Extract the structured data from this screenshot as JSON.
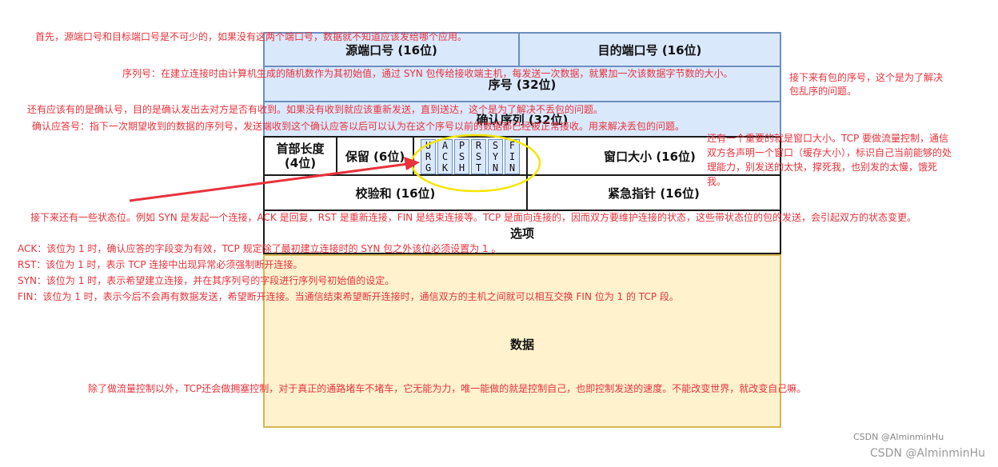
{
  "header": {
    "src_port": "源端口号 (16位)",
    "dst_port": "目的端口号 (16位)",
    "seq": "序号 (32位)",
    "ack": "确认序列 (32位)",
    "hdr_len_1": "首部长度",
    "hdr_len_2": "(4位)",
    "reserved": "保留 (6位)",
    "flags": [
      {
        "chars": [
          "U",
          "R",
          "G"
        ]
      },
      {
        "chars": [
          "A",
          "C",
          "K"
        ]
      },
      {
        "chars": [
          "P",
          "S",
          "H"
        ]
      },
      {
        "chars": [
          "R",
          "S",
          "T"
        ]
      },
      {
        "chars": [
          "S",
          "Y",
          "N"
        ]
      },
      {
        "chars": [
          "F",
          "I",
          "N"
        ]
      }
    ],
    "window": "窗口大小 (16位)",
    "checksum": "校验和 (16位)",
    "urgent": "紧急指针 (16位)",
    "options": "选项",
    "data": "数据"
  },
  "notes": {
    "ports": "首先，源端口号和目标端口号是不可少的，如果没有这两个端口号，数据就不知道应该发给哪个应用。",
    "seq": "序列号：在建立连接时由计算机生成的随机数作为其初始值，通过 SYN 包传给接收端主机，每发送一次数据，就累加一次该数据字节数的大小。",
    "seq_right": "接下来有包的序号，这个是为了解决包乱序的问题。",
    "ack_intro": "还有应该有的是确认号，目的是确认发出去对方是否有收到。如果没有收到就应该重新发送，直到送达，这个是为了解决不丢包的问题。",
    "ack_def": "确认应答号：指下一次期望收到的数据的序列号，发送端收到这个确认应答以后可以认为在这个序号以前的数据都已经被正常接收。用来解决丢包的问题。",
    "window": "还有一个重要的就是窗口大小。TCP 要做流量控制，通信双方各声明一个窗口（缓存大小），标识自己当前能够的处理能力，别发送的太快，撑死我，也别发的太慢，饿死我。",
    "flags_intro": "接下来还有一些状态位。例如 SYN 是发起一个连接，ACK 是回复，RST 是重新连接，FIN 是结束连接等。TCP 是面向连接的，因而双方要维护连接的状态，这些带状态位的包的发送，会引起双方的状态变更。",
    "ack_flag": "ACK：该位为 1 时，确认应答的字段变为有效，TCP 规定除了最初建立连接时的 SYN 包之外该位必须设置为 1 。",
    "rst_flag": "RST：该位为 1 时，表示 TCP 连接中出现异常必须强制断开连接。",
    "syn_flag": "SYN：该位为 1 时，表示希望建立连接，并在其序列号的字段进行序列号初始值的设定。",
    "fin_flag": "FIN：该位为 1 时，表示今后不会再有数据发送，希望断开连接。当通信结束希望断开连接时，通信双方的主机之间就可以相互交换 FIN 位为 1 的 TCP 段。",
    "congestion": "除了做流量控制以外，TCP还会做拥塞控制，对于真正的通路堵车不堵车，它无能为力，唯一能做的就是控制自己，也即控制发送的速度。不能改变世界，就改变自己嘛。"
  },
  "watermarks": {
    "inner": "CSDN @AlminminHu",
    "outer": "CSDN @AlminminHu"
  },
  "colors": {
    "note_red": "#e8323c",
    "blue_fill": "#dae8fc",
    "yellow_fill": "#fff2cc",
    "ellipse": "#f5e600"
  }
}
